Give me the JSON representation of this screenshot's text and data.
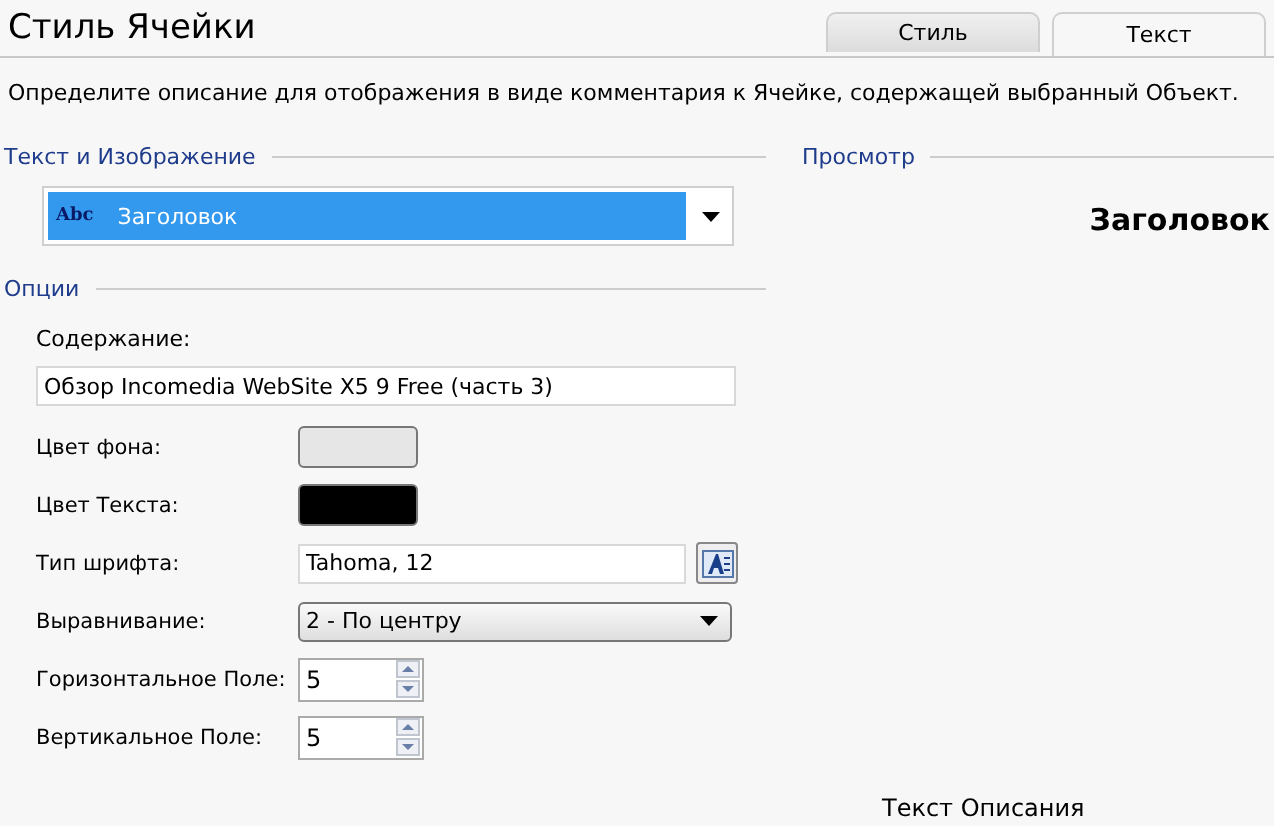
{
  "window": {
    "title": "Стиль Ячейки"
  },
  "tabs": [
    {
      "label": "Стиль",
      "selected": false
    },
    {
      "label": "Текст",
      "selected": true
    }
  ],
  "description": "Определите описание для отображения в виде комментария к Ячейке, содержащей выбранный Объект.",
  "text_and_image": {
    "heading": "Текст и Изображение",
    "style_select": {
      "badge": "Abc",
      "value": "Заголовок",
      "selected": true
    }
  },
  "options": {
    "heading": "Опции",
    "content_label": "Содержание:",
    "content_value": "Обзор Incomedia WebSite X5 9 Free (часть 3)",
    "fields": [
      {
        "kind": "color",
        "label": "Цвет фона:",
        "color": "#e6e6e6"
      },
      {
        "kind": "color",
        "label": "Цвет Текста:",
        "color": "#000000"
      },
      {
        "kind": "font",
        "label": "Тип шрифта:",
        "value": "Tahoma, 12"
      },
      {
        "kind": "select",
        "label": "Выравнивание:",
        "value": "2 - По центру"
      },
      {
        "kind": "spin",
        "label": "Горизонтальное Поле:",
        "value": "5"
      },
      {
        "kind": "spin",
        "label": "Вертикальное Поле:",
        "value": "5"
      }
    ]
  },
  "preview": {
    "heading": "Просмотр",
    "title": "Заголовок",
    "caption": "Текст Описания"
  }
}
